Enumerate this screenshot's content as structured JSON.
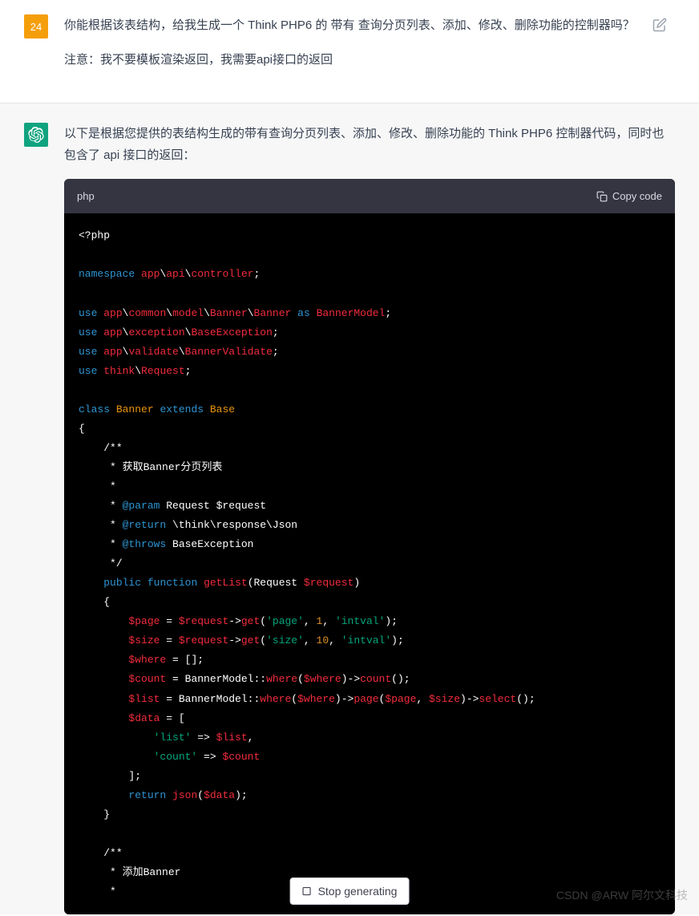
{
  "user": {
    "badge": "24",
    "message_line1": "你能根据该表结构，给我生成一个 Think PHP6 的 带有 查询分页列表、添加、修改、删除功能的控制器吗？",
    "message_line2": "注意：我不要模板渲染返回，我需要api接口的返回"
  },
  "ai": {
    "intro": "以下是根据您提供的表结构生成的带有查询分页列表、添加、修改、删除功能的 Think PHP6 控制器代码，同时也包含了 api 接口的返回："
  },
  "code": {
    "language": "php",
    "copy_label": "Copy code",
    "tokens": {
      "php_open": "<?php",
      "namespace": "namespace",
      "app": "app",
      "api": "api",
      "controller": "controller",
      "use": "use",
      "common": "common",
      "model": "model",
      "Banner": "Banner",
      "as": "as",
      "BannerModel": "BannerModel",
      "exception": "exception",
      "BaseException": "BaseException",
      "validate": "validate",
      "BannerValidate": "BannerValidate",
      "think": "think",
      "Request": "Request",
      "class": "class",
      "extends": "extends",
      "Base": "Base",
      "comment_start": "/**",
      "comment_getlist": " * 获取Banner分页列表",
      "comment_star": " *",
      "at_param": "@param",
      "param_text": " Request $request",
      "at_return": "@return",
      "return_text": " \\think\\response\\Json",
      "at_throws": "@throws",
      "throws_text": " BaseException",
      "comment_end": " */",
      "public": "public",
      "function": "function",
      "getList": "getList",
      "dollar_request": "$request",
      "dollar_page": "$page",
      "dollar_size": "$size",
      "dollar_where": "$where",
      "dollar_count": "$count",
      "dollar_list": "$list",
      "dollar_data": "$data",
      "get": "get",
      "str_page": "'page'",
      "num_1": "1",
      "str_intval": "'intval'",
      "str_size": "'size'",
      "num_10": "10",
      "where": "where",
      "count": "count",
      "page": "page",
      "select": "select",
      "str_list": "'list'",
      "str_count": "'count'",
      "return": "return",
      "json": "json",
      "comment_add": " * 添加Banner"
    }
  },
  "stop_btn": "Stop generating",
  "watermark": "CSDN @ARW 阿尔文科技"
}
